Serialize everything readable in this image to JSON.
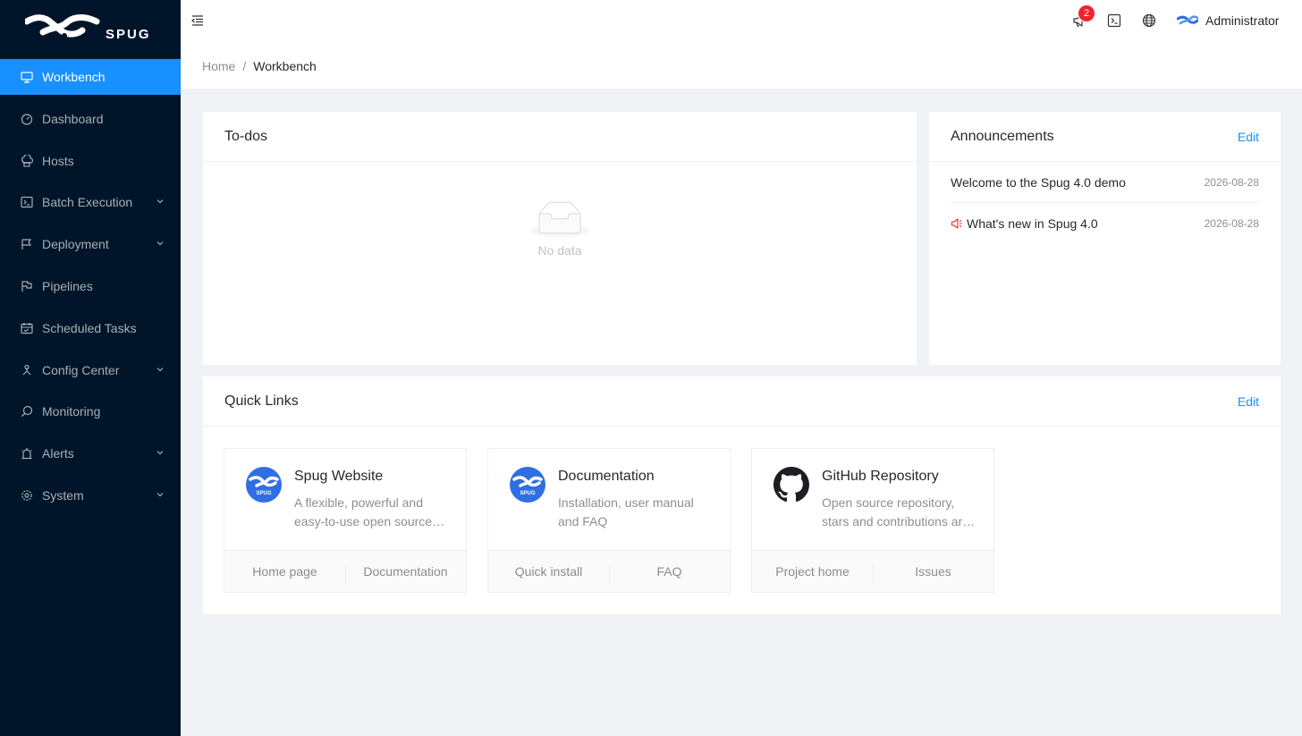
{
  "brand": {
    "name": "SPUG"
  },
  "sidebar": {
    "items": [
      {
        "label": "Workbench",
        "icon": "desktop-icon",
        "active": true
      },
      {
        "label": "Dashboard",
        "icon": "dashboard-icon"
      },
      {
        "label": "Hosts",
        "icon": "cloud-server-icon"
      },
      {
        "label": "Batch Execution",
        "icon": "code-icon",
        "expandable": true
      },
      {
        "label": "Deployment",
        "icon": "flag-icon",
        "expandable": true
      },
      {
        "label": "Pipelines",
        "icon": "flag-outline-icon"
      },
      {
        "label": "Scheduled Tasks",
        "icon": "schedule-icon"
      },
      {
        "label": "Config Center",
        "icon": "deployment-unit-icon",
        "expandable": true
      },
      {
        "label": "Monitoring",
        "icon": "monitor-icon"
      },
      {
        "label": "Alerts",
        "icon": "alert-icon",
        "expandable": true
      },
      {
        "label": "System",
        "icon": "setting-icon",
        "expandable": true
      }
    ]
  },
  "header": {
    "notification_count": "2",
    "user_name": "Administrator"
  },
  "breadcrumb": {
    "home": "Home",
    "separator": "/",
    "current": "Workbench"
  },
  "todos": {
    "title": "To-dos",
    "empty_text": "No data"
  },
  "announcements": {
    "title": "Announcements",
    "edit_label": "Edit",
    "items": [
      {
        "title": "Welcome to the Spug 4.0 demo",
        "date": "2026-08-28"
      },
      {
        "title": "What's new in Spug 4.0",
        "date": "2026-08-28"
      }
    ]
  },
  "quick_links": {
    "title": "Quick Links",
    "edit_label": "Edit",
    "cards": [
      {
        "title": "Spug Website",
        "desc": "A flexible, powerful and easy-to-use open source operations platform",
        "actions": [
          "Home page",
          "Documentation"
        ],
        "avatar_text": "SPUG"
      },
      {
        "title": "Documentation",
        "desc": "Installation, user manual and FAQ",
        "actions": [
          "Quick install",
          "FAQ"
        ],
        "avatar_text": "SPUG"
      },
      {
        "title": "GitHub Repository",
        "desc": "Open source repository, stars and contributions are welcome",
        "actions": [
          "Project home",
          "Issues"
        ]
      }
    ]
  },
  "colors": {
    "sidebar_bg": "#001529",
    "primary": "#1890ff",
    "badge": "#f5222d",
    "avatar_blue": "#2f6fe4"
  }
}
